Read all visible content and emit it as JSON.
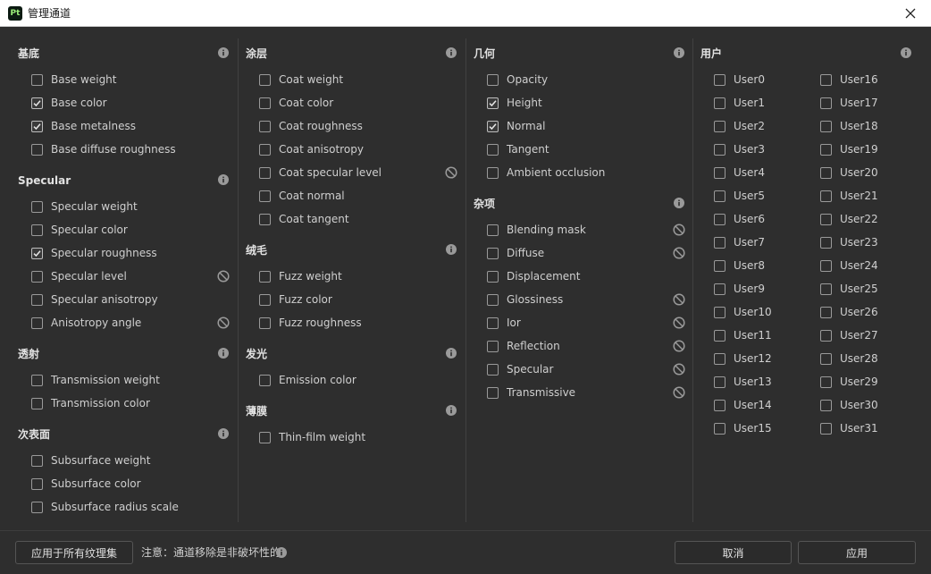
{
  "window": {
    "title": "管理通道",
    "app_icon_text": "Pt"
  },
  "columns": [
    {
      "sections": [
        {
          "title": "基底",
          "items": [
            {
              "label": "Base weight",
              "checked": false
            },
            {
              "label": "Base color",
              "checked": true
            },
            {
              "label": "Base metalness",
              "checked": true
            },
            {
              "label": "Base diffuse roughness",
              "checked": false
            }
          ]
        },
        {
          "title": "Specular",
          "items": [
            {
              "label": "Specular weight",
              "checked": false
            },
            {
              "label": "Specular color",
              "checked": false
            },
            {
              "label": "Specular roughness",
              "checked": true
            },
            {
              "label": "Specular level",
              "checked": false,
              "unsupported": true
            },
            {
              "label": "Specular anisotropy",
              "checked": false
            },
            {
              "label": "Anisotropy angle",
              "checked": false,
              "unsupported": true
            }
          ]
        },
        {
          "title": "透射",
          "items": [
            {
              "label": "Transmission weight",
              "checked": false
            },
            {
              "label": "Transmission color",
              "checked": false
            }
          ]
        },
        {
          "title": "次表面",
          "items": [
            {
              "label": "Subsurface weight",
              "checked": false
            },
            {
              "label": "Subsurface color",
              "checked": false
            },
            {
              "label": "Subsurface radius scale",
              "checked": false
            }
          ]
        }
      ]
    },
    {
      "sections": [
        {
          "title": "涂层",
          "items": [
            {
              "label": "Coat weight",
              "checked": false
            },
            {
              "label": "Coat color",
              "checked": false
            },
            {
              "label": "Coat roughness",
              "checked": false
            },
            {
              "label": "Coat anisotropy",
              "checked": false
            },
            {
              "label": "Coat specular level",
              "checked": false,
              "unsupported": true
            },
            {
              "label": "Coat normal",
              "checked": false
            },
            {
              "label": "Coat tangent",
              "checked": false
            }
          ]
        },
        {
          "title": "绒毛",
          "items": [
            {
              "label": "Fuzz weight",
              "checked": false
            },
            {
              "label": "Fuzz color",
              "checked": false
            },
            {
              "label": "Fuzz roughness",
              "checked": false
            }
          ]
        },
        {
          "title": "发光",
          "items": [
            {
              "label": "Emission color",
              "checked": false
            }
          ]
        },
        {
          "title": "薄膜",
          "items": [
            {
              "label": "Thin-film weight",
              "checked": false
            }
          ]
        }
      ]
    },
    {
      "sections": [
        {
          "title": "几何",
          "items": [
            {
              "label": "Opacity",
              "checked": false
            },
            {
              "label": "Height",
              "checked": true
            },
            {
              "label": "Normal",
              "checked": true
            },
            {
              "label": "Tangent",
              "checked": false
            },
            {
              "label": "Ambient occlusion",
              "checked": false
            }
          ]
        },
        {
          "title": "杂项",
          "items": [
            {
              "label": "Blending mask",
              "checked": false,
              "unsupported": true
            },
            {
              "label": "Diffuse",
              "checked": false,
              "unsupported": true
            },
            {
              "label": "Displacement",
              "checked": false
            },
            {
              "label": "Glossiness",
              "checked": false,
              "unsupported": true
            },
            {
              "label": "Ior",
              "checked": false,
              "unsupported": true
            },
            {
              "label": "Reflection",
              "checked": false,
              "unsupported": true
            },
            {
              "label": "Specular",
              "checked": false,
              "unsupported": true
            },
            {
              "label": "Transmissive",
              "checked": false,
              "unsupported": true
            }
          ]
        }
      ]
    }
  ],
  "user_section": {
    "title": "用户",
    "left": [
      "User0",
      "User1",
      "User2",
      "User3",
      "User4",
      "User5",
      "User6",
      "User7",
      "User8",
      "User9",
      "User10",
      "User11",
      "User12",
      "User13",
      "User14",
      "User15"
    ],
    "right": [
      "User16",
      "User17",
      "User18",
      "User19",
      "User20",
      "User21",
      "User22",
      "User23",
      "User24",
      "User25",
      "User26",
      "User27",
      "User28",
      "User29",
      "User30",
      "User31"
    ]
  },
  "footer": {
    "apply_all_label": "应用于所有纹理集",
    "notice": "注意：通道移除是非破坏性的",
    "cancel_label": "取消",
    "apply_label": "应用"
  },
  "colors": {
    "background": "#2e2e2e",
    "titlebar": "#ffffff",
    "text": "#cfcfcf",
    "header_text": "#e2e2e2",
    "icon": "#9a9a9a"
  },
  "icons": {
    "info": "info-icon",
    "unsupported": "ban-icon",
    "checkmark": "check-icon",
    "close": "close-icon"
  }
}
